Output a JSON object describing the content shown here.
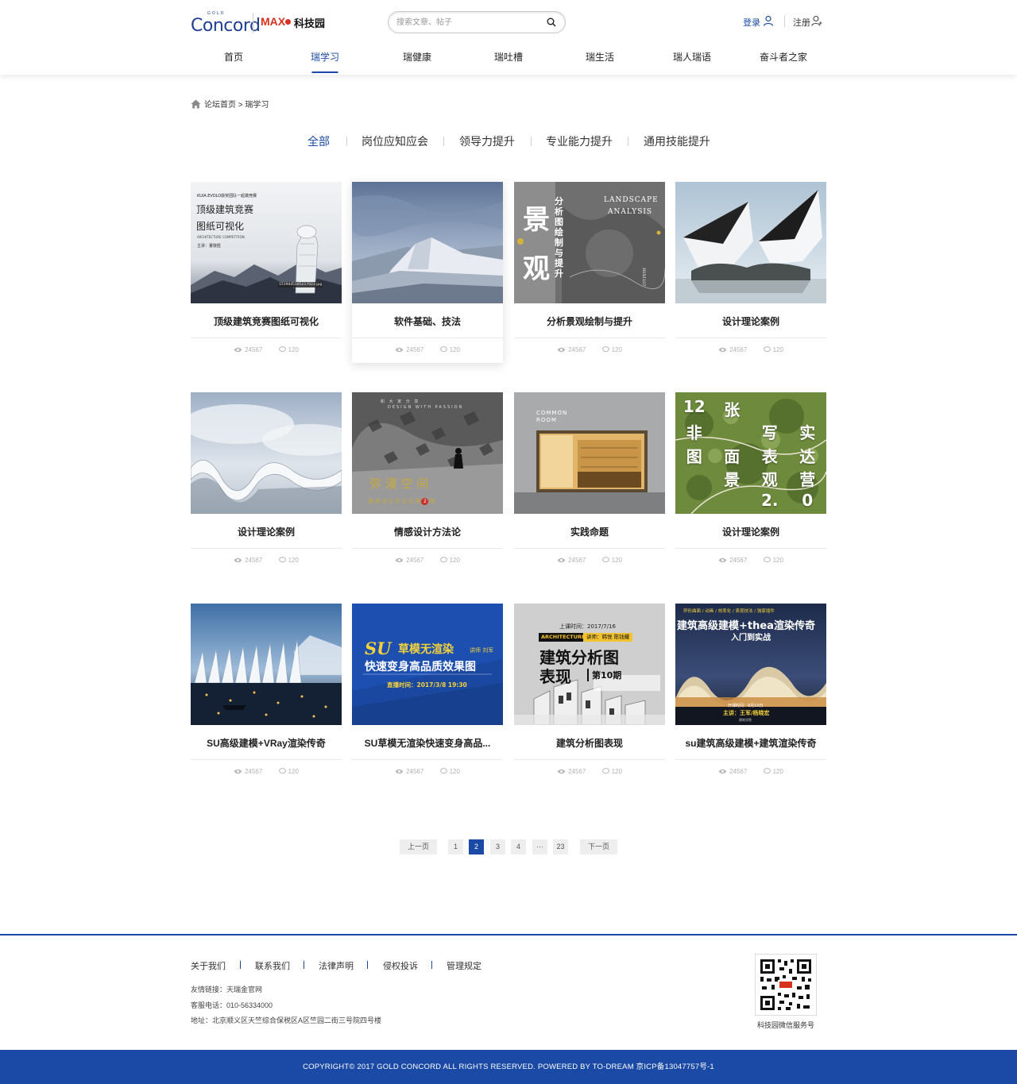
{
  "header": {
    "logo_gold": "GOLD",
    "logo_concord": "Concord",
    "logo_max": "MAX",
    "logo_kjy": "科技园",
    "search_placeholder": "搜索文章、帖子",
    "login": "登录",
    "register": "注册"
  },
  "nav": {
    "items": [
      "首页",
      "瑞学习",
      "瑞健康",
      "瑞吐槽",
      "瑞生活",
      "瑞人瑞语",
      "奋斗者之家"
    ],
    "active_index": 1
  },
  "breadcrumb": {
    "home": "论坛首页",
    "separator": ">",
    "current": "瑞学习"
  },
  "categories": {
    "items": [
      "全部",
      "岗位应知应会",
      "领导力提升",
      "专业能力提升",
      "通用技能提升"
    ],
    "active_index": 0
  },
  "cards": [
    {
      "title": "顶级建筑竞赛图纸可视化",
      "views": "24567",
      "comments": "120",
      "thumb_text": {
        "tag": "KUIA.EVOLO获奖团队一起做竞赛",
        "line1": "顶级建筑竞赛",
        "line2": "图纸可视化",
        "line3": "ARCHITECTURE COMPETITION",
        "line4": "主讲：董敬胜",
        "file": "1519445185217023.jpg"
      }
    },
    {
      "title": "软件基础、技法",
      "views": "24567",
      "comments": "120"
    },
    {
      "title": "分析景观绘制与提升",
      "views": "24567",
      "comments": "120",
      "thumb_text": {
        "big1": "景",
        "big2": "观",
        "vert": "分析图绘制与提升",
        "en1": "LANDSCAPE",
        "en2": "ANALYSIS",
        "date": "2015/11/17"
      }
    },
    {
      "title": "设计理论案例",
      "views": "24567",
      "comments": "120"
    },
    {
      "title": "设计理论案例",
      "views": "24567",
      "comments": "120"
    },
    {
      "title": "情感设计方法论",
      "views": "24567",
      "comments": "120",
      "thumb_text": {
        "top": "和 大 家 分 享",
        "en": "DESIGN WITH PASSION",
        "main": "弥 漫 空 间",
        "sub": "情 感 设 计 方 法 论 第",
        "num": "2",
        "tail": "期"
      }
    },
    {
      "title": "实践命题",
      "views": "24567",
      "comments": "120",
      "thumb_text": {
        "sign1": "COMMON",
        "sign2": "ROOM"
      }
    },
    {
      "title": "设计理论案例",
      "views": "24567",
      "comments": "120",
      "thumb_text": {
        "grid": [
          "12",
          "张",
          "",
          "",
          "非",
          "",
          "写",
          "实",
          "图",
          "面",
          "表",
          "达",
          "",
          "景",
          "观",
          "营",
          "",
          "",
          "2.",
          "0"
        ]
      }
    },
    {
      "title": "SU高级建模+VRay渲染传奇",
      "views": "24567",
      "comments": "120"
    },
    {
      "title": "SU草模无渲染快速变身高品...",
      "views": "24567",
      "comments": "120",
      "thumb_text": {
        "su": "SU",
        "l1": "草模无渲染",
        "teacher": "讲师 刘军",
        "l2": "快速变身高品质效果图",
        "time": "直播时间：2017/3/8 19:30"
      }
    },
    {
      "title": "建筑分析图表现",
      "views": "24567",
      "comments": "120",
      "thumb_text": {
        "time": "上课时间：2017/7/16",
        "tag": "ARCHITECTURE",
        "teacher": "讲师：韩悦 陈钱耀",
        "l1": "建筑分析图",
        "l2": "表现",
        "issue": "第10期"
      }
    },
    {
      "title": "su建筑高级建模+建筑渲染传奇",
      "views": "24567",
      "comments": "120",
      "thumb_text": {
        "top": "异形曲面 / 动画 / 效率化 / 表现技法 / 独家插件",
        "l1": "建筑高级建模+thea渲染传奇",
        "l2": "入门到实战",
        "time": "开课时间：8月10日",
        "teacher": "主讲：王军/杨晓宏",
        "school": "建筑学院"
      }
    }
  ],
  "pagination": {
    "prev": "上一页",
    "pages": [
      "1",
      "2",
      "3",
      "4",
      "···",
      "23"
    ],
    "active": "2",
    "next": "下一页"
  },
  "footer": {
    "links": [
      "关于我们",
      "联系我们",
      "法律声明",
      "侵权投诉",
      "管理规定"
    ],
    "friend_links": "友情链接：天瑞金官网",
    "phone": "客服电话：010-56334000",
    "address": "地址：北京顺义区天竺综合保税区A区竺园二街三号院四号楼",
    "qr_label": "科技园微信服务号",
    "copyright": "COPYRIGHT© 2017  GOLD CONCORD ALL RIGHTS RESERVED. POWERED BY TO-DREAM   京ICP备13047757号-1"
  },
  "colors": {
    "brand_blue": "#1a4aa5",
    "logo_red": "#d7321f",
    "pagination_bg": "#eeeeee"
  }
}
